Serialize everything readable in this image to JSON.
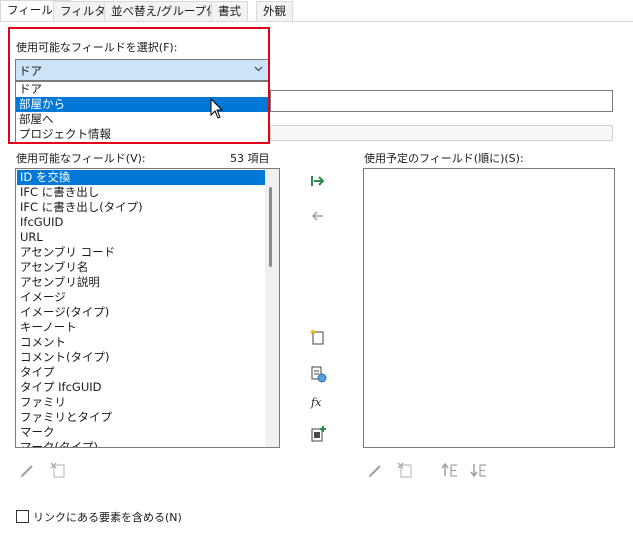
{
  "tabs": [
    {
      "label": "フィールド",
      "active": true
    },
    {
      "label": "フィルタ",
      "active": false
    },
    {
      "label": "並べ替え/グループ化",
      "active": false
    },
    {
      "label": "書式",
      "active": false
    },
    {
      "label": "外観",
      "active": false
    }
  ],
  "category": {
    "label": "使用可能なフィールドを選択(F):",
    "selected": "ドア",
    "options": [
      "ドア",
      "部屋から",
      "部屋へ",
      "プロジェクト情報"
    ],
    "highlighted_option": "部屋から"
  },
  "available": {
    "label": "使用可能なフィールド(V):",
    "count": "53 項目",
    "items": [
      "ID を交換",
      "IFC に書き出し",
      "IFC に書き出し(タイプ)",
      "IfcGUID",
      "URL",
      "アセンブリ コード",
      "アセンブリ名",
      "アセンブリ説明",
      "イメージ",
      "イメージ(タイプ)",
      "キーノート",
      "コメント",
      "コメント(タイプ)",
      "タイプ",
      "タイプ IfcGUID",
      "ファミリ",
      "ファミリとタイプ",
      "マーク",
      "マーク(タイプ)"
    ],
    "selected_item": "ID を交換"
  },
  "scheduled": {
    "label": "使用予定のフィールド(順に)(S):",
    "items": []
  },
  "include_links": {
    "label": "リンクにある要素を含める(N)",
    "checked": false
  },
  "colors": {
    "accent": "#0078d7",
    "highlight_border": "#e3001b",
    "combo_bg": "#cce4f7",
    "add_arrow": "#2a8a4a"
  },
  "icons": {
    "add": "arrow-right-icon",
    "remove": "arrow-left-icon",
    "new_parameter": "new-parameter-icon",
    "combine": "combine-parameters-icon",
    "calculated": "fx-icon",
    "add_param_all": "add-parameter-icon",
    "edit": "pencil-icon",
    "delete": "delete-parameter-icon",
    "move_up": "move-up-icon",
    "move_down": "move-down-icon"
  }
}
